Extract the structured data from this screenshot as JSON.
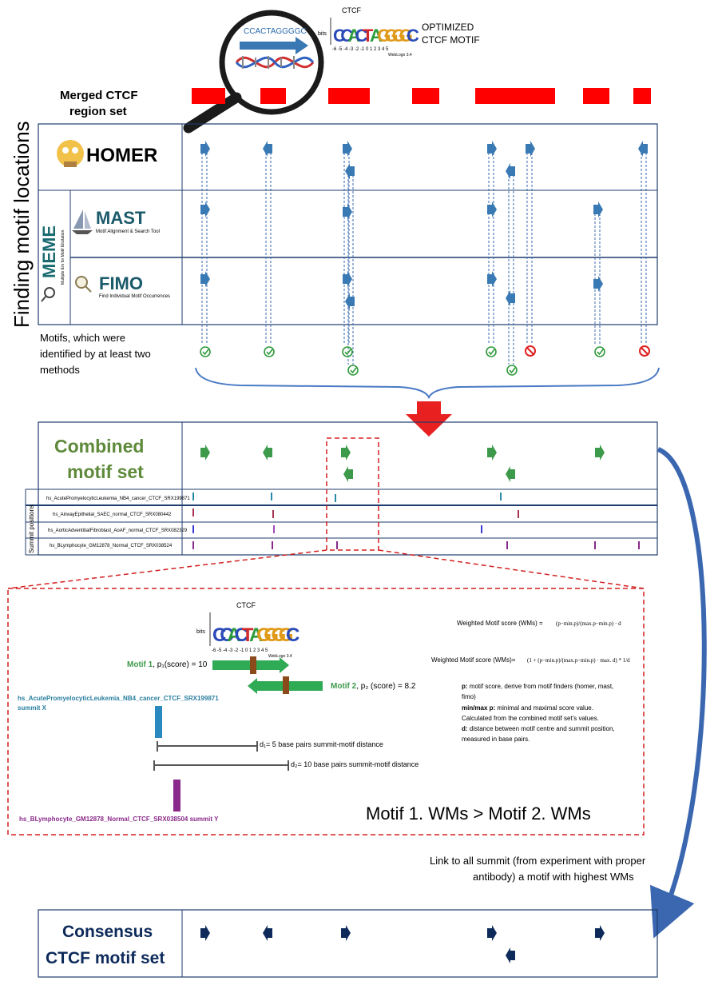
{
  "header": {
    "magnifier_sequence": "CCACTAGGGGC",
    "logo_title": "CTCF",
    "logo_bits": "bits",
    "logo_letters": [
      "C",
      "C",
      "A",
      "C",
      "T",
      "A",
      "G",
      "G",
      "G",
      "G",
      "C"
    ],
    "logo_positions": "-6 -5 -4 -3 -2 -1  0  1  2  3  4  5",
    "logo_credit": "WebLogo 3.4",
    "optimized_line1": "OPTIMIZED",
    "optimized_line2": "CTCF MOTIF",
    "merged_line1": "Merged CTCF",
    "merged_line2": "region set"
  },
  "side_title": "Finding motif locations",
  "methods": {
    "homer": "HOMER",
    "meme": "MEME",
    "meme_sub": "Multiple Em for Motif Elicitation",
    "mast": "MAST",
    "mast_sub": "Motif Alignment & Search Tool",
    "fimo": "FIMO",
    "fimo_sub": "Find Individual Motif Occurrences"
  },
  "motifs_note": [
    "Motifs, which were",
    "identified by at least two",
    "methods"
  ],
  "combined": {
    "title_line1": "Combined",
    "title_line2": "motif set",
    "summit_label": "Summit positions",
    "samples": [
      "hs_AcutePromyelocyticLeukemia_NB4_cancer_CTCF_SRX199871",
      "hs_AirwayEpithelial_SAEC_normal_CTCF_SRX080442",
      "hs_AorticAdventitialFibroblast_AoAF_normal_CTCF_SRX082329",
      "hs_BLymphocyte_GM12878_Normal_CTCF_SRX038524"
    ]
  },
  "zoom": {
    "logo_title": "CTCF",
    "logo_bits": "bits",
    "logo_letters": [
      "C",
      "C",
      "A",
      "C",
      "T",
      "A",
      "G",
      "G",
      "G",
      "G",
      "C"
    ],
    "logo_positions": "-6 -5 -4 -3 -2 -1  0  1  2  3  4  5",
    "logo_credit": "WebLogo 3.4",
    "motif1_name": "Motif 1",
    "motif1_rest": ", p₁(score) = 10",
    "motif2_name": "Motif 2",
    "motif2_rest": ", p₂ (score) = 8.2",
    "summit_x_line1": "hs_AcutePromyelocyticLeukemia_NB4_cancer_CTCF_SRX199871",
    "summit_x_line2": "summit X",
    "d1": "d₁= 5 base pairs summit-motif distance",
    "d2": "d₂= 10 base pairs summit-motif distance",
    "summit_y": "hs_BLymphocyte_GM12878_Normal_CTCF_SRX038504 summit Y",
    "formula1_label": "Weighted Motif score (WMs) =",
    "formula1_expr": "(p−min.p)/(max.p−min.p) · d",
    "formula2_label": "Weighted Motif score  (WMs)=",
    "formula2_expr": "(1 + (p−min.p)/(max.p−min.p) · max. d) * 1/d",
    "legend": [
      {
        "key": "p:",
        "text": " motif score, derive from motif finders (homer, mast,"
      },
      {
        "key": "",
        "text": "fimo)"
      },
      {
        "key": "min/max p:",
        "text": " minimal and maximal score value."
      },
      {
        "key": "",
        "text": "Calculated from the combined motif set's values."
      },
      {
        "key": "d:",
        "text": " distance between motif centre and summit position,"
      },
      {
        "key": "",
        "text": "measured in base pairs."
      }
    ],
    "conclusion": "Motif 1. WMs > Motif 2. WMs"
  },
  "link_note": [
    "Link to all summit (from experiment with proper",
    "antibody) a motif with highest WMs"
  ],
  "consensus": {
    "title_line1": "Consensus",
    "title_line2": "CTCF motif set"
  },
  "colors": {
    "red": "#ff0000",
    "blue_arrow": "#3a78a8",
    "green": "#3d9a4a",
    "title_green": "#5e8a3a",
    "navy": "#0d2a5a",
    "teal": "#2a7fa0",
    "purple": "#7a2a8a",
    "dashed_red": "#d42020",
    "box_border": "#1f3c6e"
  },
  "icons": [
    "magnifier-icon",
    "dna-icon",
    "homer-icon",
    "sailboat-icon",
    "fimo-magnifier-icon",
    "check-icon",
    "prohibited-icon",
    "down-arrow-icon"
  ]
}
